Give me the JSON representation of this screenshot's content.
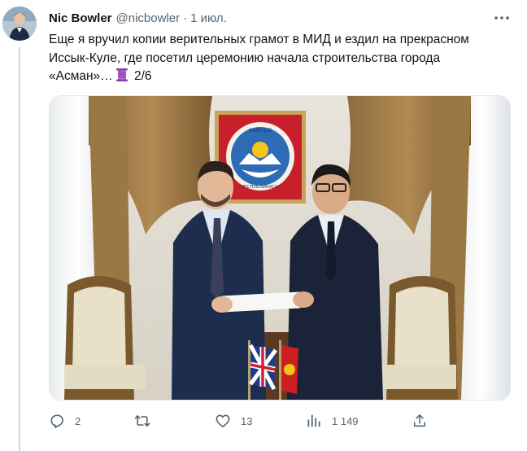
{
  "author": {
    "name": "Nic Bowler",
    "handle": "@nicbowler",
    "separator": "·",
    "time": "1 июл."
  },
  "tweet": {
    "text_main": "Еще я вручил копии верительных грамот в МИД и ездил на прекрасном Иссык-Куле, где посетил церемонию начала строительства города «Асман»…",
    "thread_emoji": "thread-spool-icon",
    "thread_index": "2/6"
  },
  "media": {
    "emblem_text_top": "КЫРГЫЗ",
    "emblem_text_bottom": "РЕСПУБЛИКАСЫ"
  },
  "actions": {
    "replies": "2",
    "retweets": "",
    "likes": "13",
    "views": "1 149"
  },
  "colors": {
    "text": "#0f1419",
    "secondary": "#536471",
    "border": "#cfd9de"
  }
}
